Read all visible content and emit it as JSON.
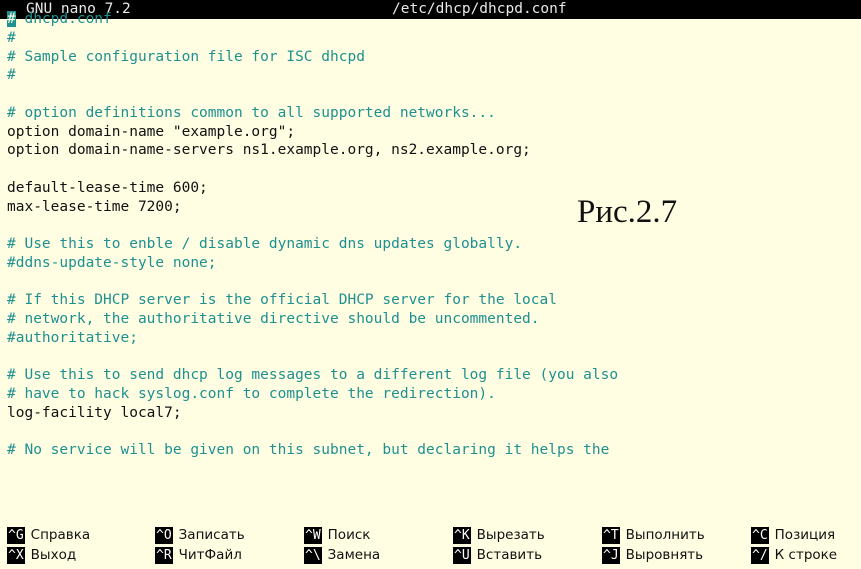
{
  "titlebar": {
    "app": "GNU nano 7.2",
    "file": "/etc/dhcp/dhcpd.conf"
  },
  "editor": {
    "lines": [
      {
        "text": "# dhcpd.conf",
        "type": "comment"
      },
      {
        "text": "#",
        "type": "comment"
      },
      {
        "text": "# Sample configuration file for ISC dhcpd",
        "type": "comment"
      },
      {
        "text": "#",
        "type": "comment"
      },
      {
        "text": "",
        "type": "code"
      },
      {
        "text": "# option definitions common to all supported networks...",
        "type": "comment"
      },
      {
        "text": "option domain-name \"example.org\";",
        "type": "code"
      },
      {
        "text": "option domain-name-servers ns1.example.org, ns2.example.org;",
        "type": "code"
      },
      {
        "text": "",
        "type": "code"
      },
      {
        "text": "default-lease-time 600;",
        "type": "code"
      },
      {
        "text": "max-lease-time 7200;",
        "type": "code"
      },
      {
        "text": "",
        "type": "code"
      },
      {
        "text": "# Use this to enble / disable dynamic dns updates globally.",
        "type": "comment"
      },
      {
        "text": "#ddns-update-style none;",
        "type": "comment"
      },
      {
        "text": "",
        "type": "code"
      },
      {
        "text": "# If this DHCP server is the official DHCP server for the local",
        "type": "comment"
      },
      {
        "text": "# network, the authoritative directive should be uncommented.",
        "type": "comment"
      },
      {
        "text": "#authoritative;",
        "type": "comment"
      },
      {
        "text": "",
        "type": "code"
      },
      {
        "text": "# Use this to send dhcp log messages to a different log file (you also",
        "type": "comment"
      },
      {
        "text": "# have to hack syslog.conf to complete the redirection).",
        "type": "comment"
      },
      {
        "text": "log-facility local7;",
        "type": "code"
      },
      {
        "text": "",
        "type": "code"
      },
      {
        "text": "# No service will be given on this subnet, but declaring it helps the",
        "type": "comment"
      }
    ]
  },
  "annotation": "Рис.2.7",
  "shortcuts": [
    {
      "key": "^G",
      "label": "Справка"
    },
    {
      "key": "^X",
      "label": "Выход"
    },
    {
      "key": "^O",
      "label": "Записать"
    },
    {
      "key": "^R",
      "label": "ЧитФайл"
    },
    {
      "key": "^W",
      "label": "Поиск"
    },
    {
      "key": "^\\",
      "label": "Замена"
    },
    {
      "key": "^K",
      "label": "Вырезать"
    },
    {
      "key": "^U",
      "label": "Вставить"
    },
    {
      "key": "^T",
      "label": "Выполнить"
    },
    {
      "key": "^J",
      "label": "Выровнять"
    },
    {
      "key": "^C",
      "label": "Позиция"
    },
    {
      "key": "^/",
      "label": "К строке"
    }
  ]
}
